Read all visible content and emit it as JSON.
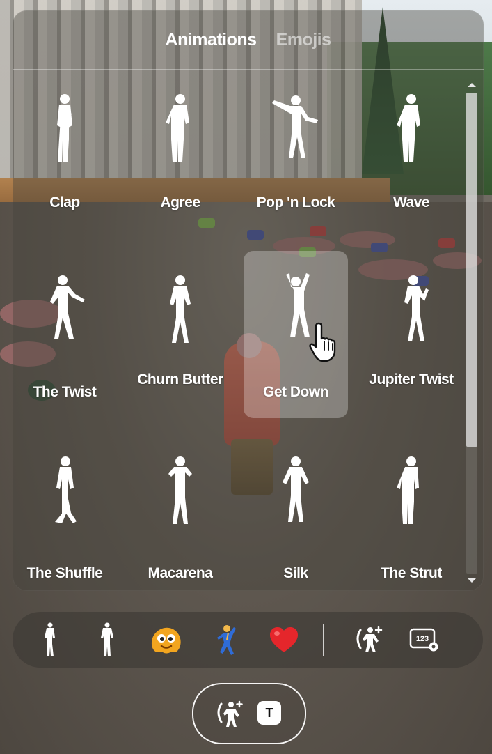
{
  "tabs": [
    {
      "label": "Animations",
      "active": true
    },
    {
      "label": "Emojis",
      "active": false
    }
  ],
  "animations": [
    {
      "label": "Clap",
      "icon": "clap-figure-icon"
    },
    {
      "label": "Agree",
      "icon": "agree-figure-icon"
    },
    {
      "label": "Pop 'n Lock",
      "icon": "pop-n-lock-figure-icon"
    },
    {
      "label": "Wave",
      "icon": "wave-figure-icon"
    },
    {
      "label": "The Twist",
      "icon": "twist-figure-icon"
    },
    {
      "label": "Churn Butter",
      "icon": "churn-butter-figure-icon"
    },
    {
      "label": "Get Down",
      "icon": "get-down-figure-icon",
      "hovered": true
    },
    {
      "label": "Jupiter Twist",
      "icon": "jupiter-twist-figure-icon"
    },
    {
      "label": "The Shuffle",
      "icon": "shuffle-figure-icon"
    },
    {
      "label": "Macarena",
      "icon": "macarena-figure-icon"
    },
    {
      "label": "Silk",
      "icon": "silk-figure-icon"
    },
    {
      "label": "The Strut",
      "icon": "strut-figure-icon"
    }
  ],
  "quickbar": {
    "items": [
      "figure-icon",
      "figure-icon",
      "blob-emoji-icon",
      "dancer-emoji-icon",
      "heart-emoji-icon",
      "emote-add-icon",
      "keybind-settings-icon"
    ],
    "keybind_icon_text": "123"
  },
  "toggle": {
    "key": "T",
    "icon": "emote-toggle-icon"
  },
  "colors": {
    "panel": "#46423c",
    "heart": "#e5262b",
    "blob": "#f2a51f",
    "dancer": "#2f6cd8"
  }
}
